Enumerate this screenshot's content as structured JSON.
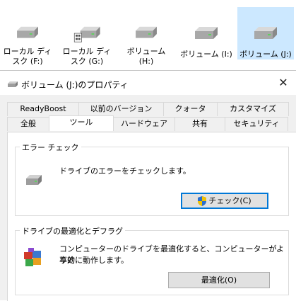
{
  "drives": [
    {
      "line1": "ローカル ディ",
      "line2": "スク (F:)",
      "selected": false,
      "overlay": false
    },
    {
      "line1": "ローカル ディ",
      "line2": "スク (G:)",
      "selected": false,
      "overlay": true
    },
    {
      "line1": "ボリューム",
      "line2": "(H:)",
      "selected": false,
      "overlay": false
    },
    {
      "line1": "ボリューム (I:)",
      "line2": "",
      "selected": false,
      "overlay": false
    },
    {
      "line1": "ボリューム (J:)",
      "line2": "",
      "selected": true,
      "overlay": false
    }
  ],
  "dialog": {
    "title": "ボリューム (J:)のプロパティ",
    "close_glyph": "✕",
    "tabs_row1": [
      "ReadyBoost",
      "以前のバージョン",
      "クォータ",
      "カスタマイズ"
    ],
    "tabs_row2": [
      "全般",
      "ツール",
      "ハードウェア",
      "共有",
      "セキュリティ"
    ],
    "active_tab": "ツール"
  },
  "error_check": {
    "title": "エラー チェック",
    "description": "ドライブのエラーをチェックします。",
    "button": "チェック(C)"
  },
  "optimize": {
    "title": "ドライブの最適化とデフラグ",
    "description_line1": "コンピューターのドライブを最適化すると、コンピューターがより効",
    "description_line2": "率的に動作します。",
    "button": "最適化(O)"
  },
  "colors": {
    "selection": "#cce8ff",
    "accent": "#0078d7"
  }
}
